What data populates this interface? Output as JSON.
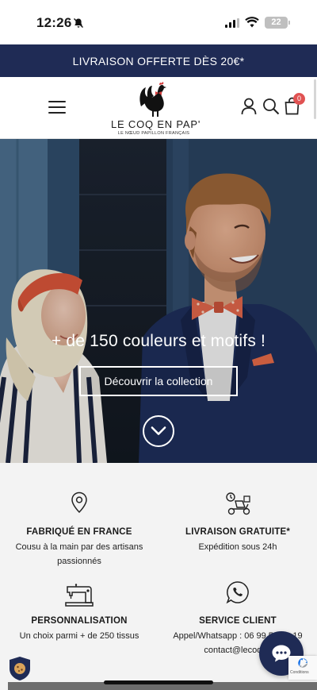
{
  "status_bar": {
    "time": "12:26",
    "battery": "22"
  },
  "promo": {
    "text": "LIVRAISON OFFERTE DÈS 20€*"
  },
  "header": {
    "logo_name": "LE COQ EN PAP'",
    "logo_tagline": "LE NŒUD PAPILLON FRANÇAIS",
    "cart_count": "0",
    "icons": [
      "menu-icon",
      "user-icon",
      "search-icon",
      "cart-icon"
    ]
  },
  "hero": {
    "title": "+ de 150 couleurs et motifs !",
    "button_label": "Découvrir la collection"
  },
  "features": [
    {
      "icon": "location-pin-icon",
      "title": "FABRIQUÉ EN FRANCE",
      "text": "Cousu à la main par des artisans passionnés"
    },
    {
      "icon": "delivery-scooter-icon",
      "title": "LIVRAISON GRATUITE*",
      "text": "Expédition sous 24h"
    },
    {
      "icon": "sewing-machine-icon",
      "title": "PERSONNALISATION",
      "text": "Un choix parmi + de 250 tissus"
    },
    {
      "icon": "whatsapp-icon",
      "title": "SERVICE CLIENT",
      "text": "Appel/Whatsapp : 06 99 50 19 19",
      "text2": "contact@lecoqen"
    }
  ],
  "recaptcha": {
    "text": "Conditions"
  },
  "colors": {
    "navy": "#1f2b55",
    "badge": "#e05252",
    "feature_bg": "#f3f3f3"
  }
}
